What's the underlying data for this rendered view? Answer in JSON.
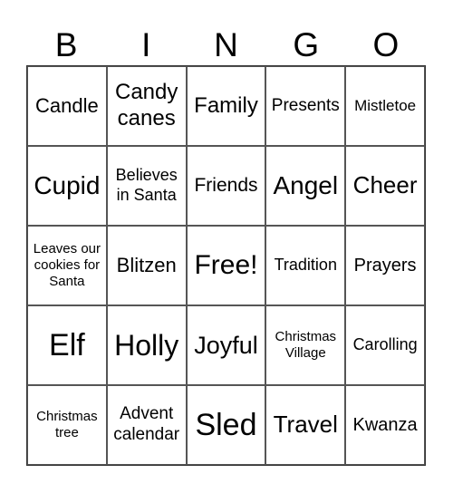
{
  "header": [
    "B",
    "I",
    "N",
    "G",
    "O"
  ],
  "cells": [
    "Candle",
    "Candy canes",
    "Family",
    "Presents",
    "Mistletoe",
    "Cupid",
    "Believes in Santa",
    "Friends",
    "Angel",
    "Cheer",
    "Leaves our cookies for Santa",
    "Blitzen",
    "Free!",
    "Tradition",
    "Prayers",
    "Elf",
    "Holly",
    "Joyful",
    "Christmas Village",
    "Carolling",
    "Christmas tree",
    "Advent calendar",
    "Sled",
    "Travel",
    "Kwanza"
  ]
}
